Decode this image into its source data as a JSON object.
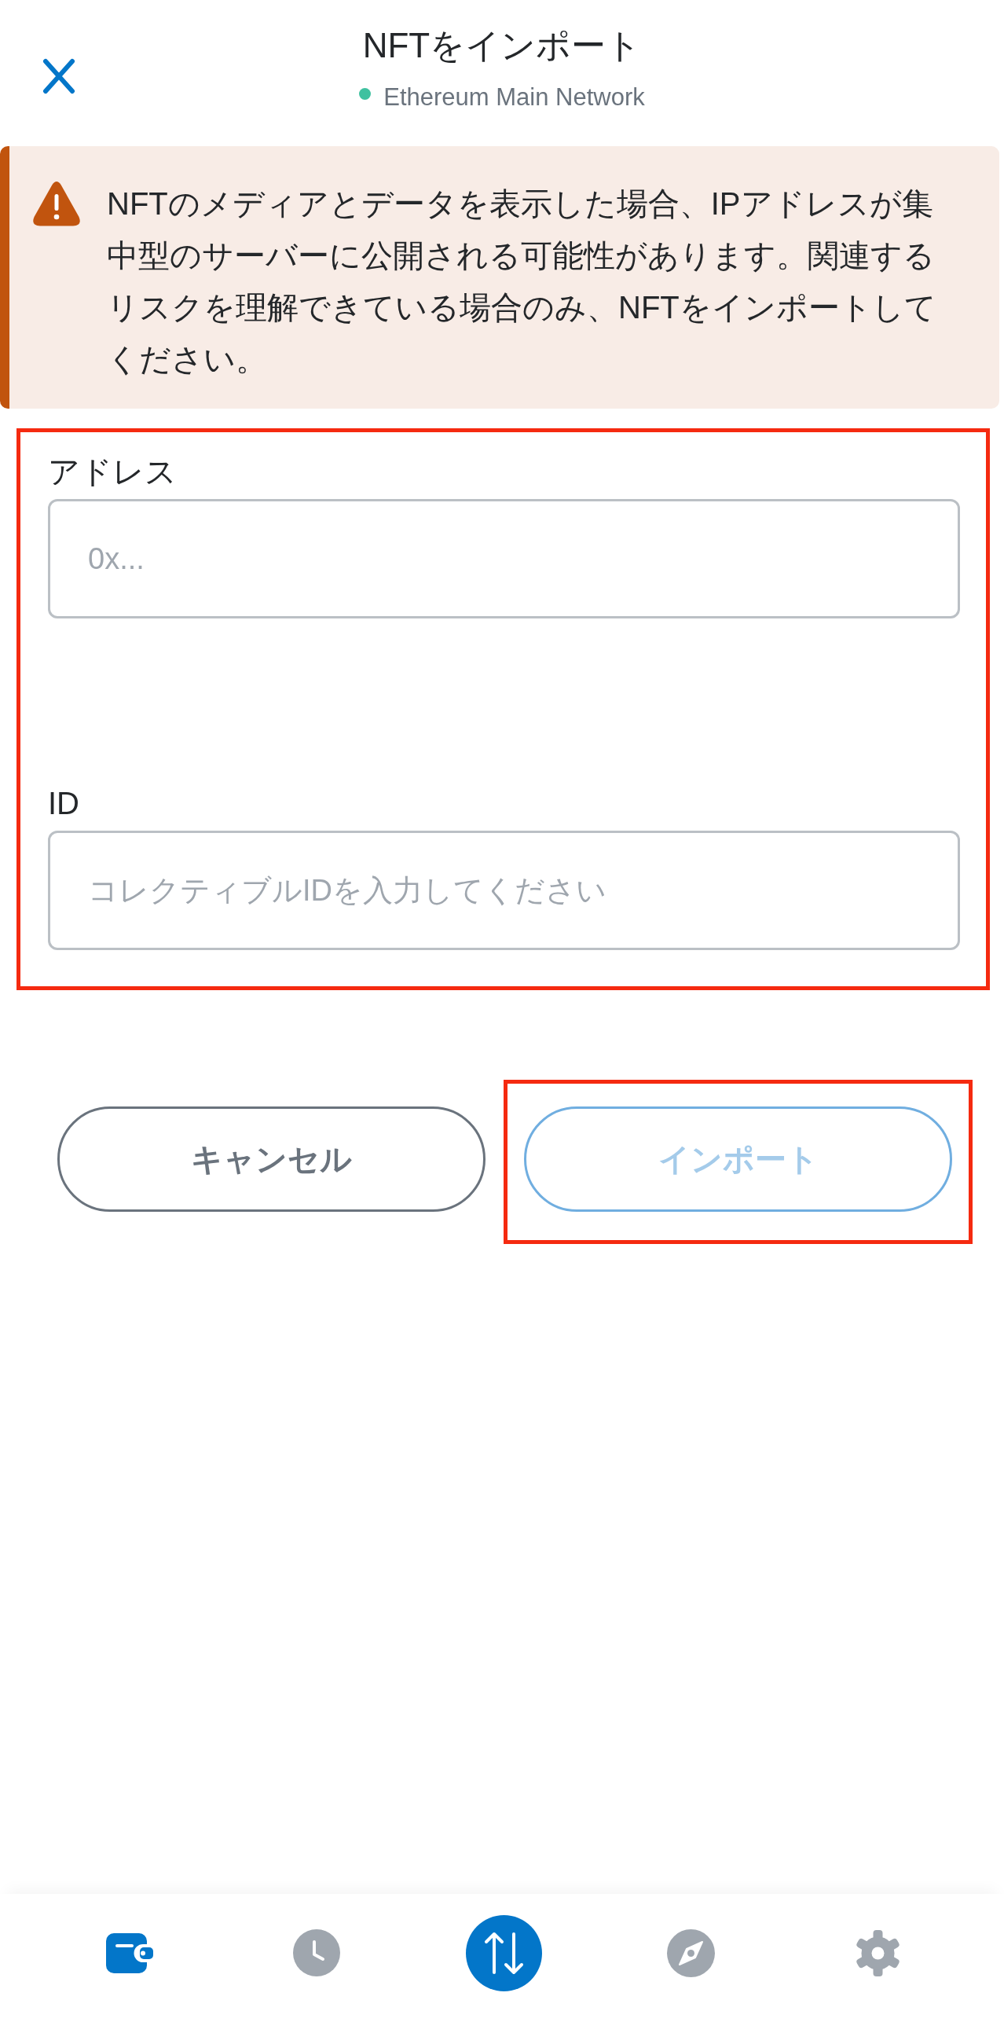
{
  "header": {
    "title": "NFTをインポート",
    "network": "Ethereum Main Network"
  },
  "warning": {
    "text": "NFTのメディアとデータを表示した場合、IPアドレスが集中型のサーバーに公開される可能性があります。関連するリスクを理解できている場合のみ、NFTをインポートしてください。"
  },
  "form": {
    "highlighted": true,
    "fields": [
      {
        "label": "アドレス",
        "placeholder": "0x..."
      },
      {
        "label": "ID",
        "placeholder": "コレクティブルIDを入力してください"
      }
    ]
  },
  "buttons": [
    {
      "label": "キャンセル",
      "kind": "secondary",
      "disabled": false,
      "highlighted": false
    },
    {
      "label": "インポート",
      "kind": "primary",
      "disabled": true,
      "highlighted": true
    }
  ],
  "bottom_nav": {
    "items": [
      {
        "kind": "tab",
        "selected": true
      },
      {
        "kind": "tab",
        "selected": false
      },
      {
        "kind": "action"
      },
      {
        "kind": "tab",
        "selected": false
      },
      {
        "kind": "tab",
        "selected": false
      }
    ]
  }
}
